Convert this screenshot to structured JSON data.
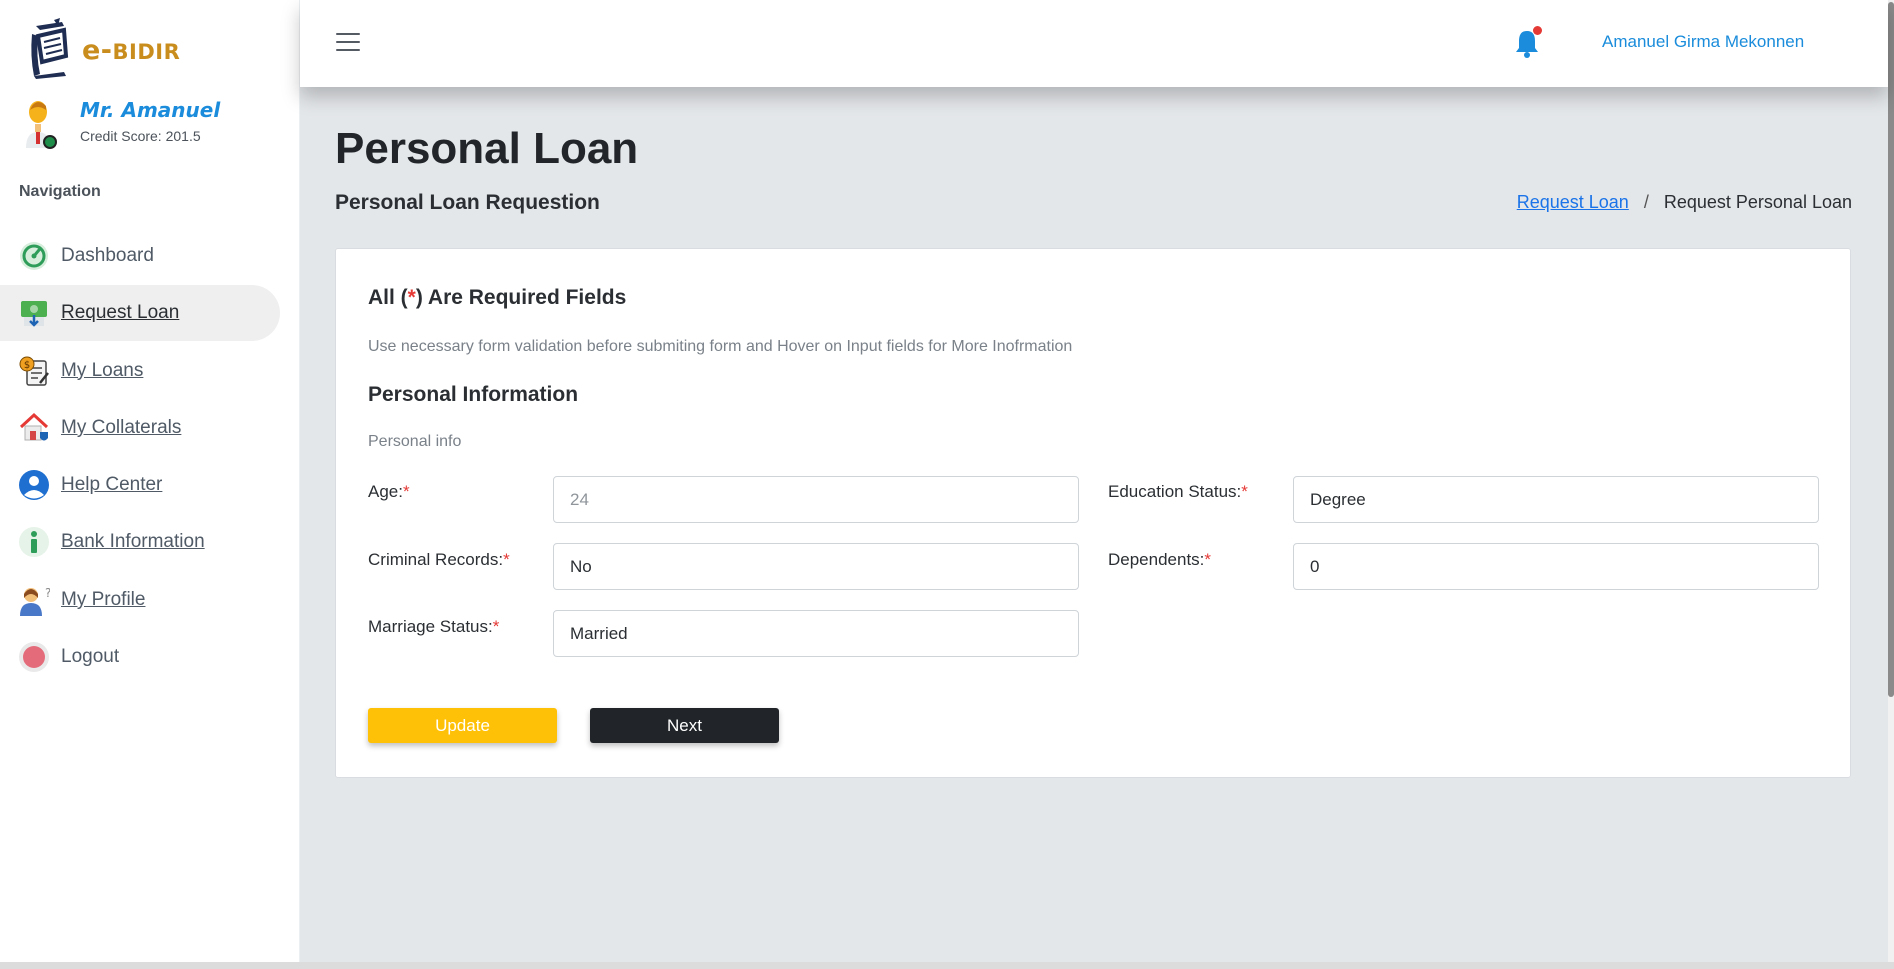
{
  "brand": {
    "prefix": "e-",
    "name": "BIDIR"
  },
  "user": {
    "name": "Mr. Amanuel",
    "credit": "Credit Score: 201.5"
  },
  "nav": {
    "heading": "Navigation",
    "items": [
      {
        "label": "Dashboard",
        "icon": "dashboard-gauge-icon"
      },
      {
        "label": "Request Loan",
        "icon": "money-download-icon"
      },
      {
        "label": "My Loans",
        "icon": "loan-document-icon"
      },
      {
        "label": "My Collaterals",
        "icon": "house-shield-icon"
      },
      {
        "label": "Help Center",
        "icon": "user-circle-icon"
      },
      {
        "label": "Bank Information",
        "icon": "info-icon"
      },
      {
        "label": "My Profile",
        "icon": "profile-person-icon"
      },
      {
        "label": "Logout",
        "icon": "logout-circle-icon"
      }
    ]
  },
  "topbar": {
    "user_name": "Amanuel Girma Mekonnen"
  },
  "page": {
    "title": "Personal Loan",
    "subtitle": "Personal Loan Requestion",
    "breadcrumb": {
      "link": "Request Loan",
      "sep": "/",
      "current": "Request Personal Loan"
    }
  },
  "form": {
    "heading_pre": "All (",
    "heading_star": "*",
    "heading_post": ") Are Required Fields",
    "note": "Use necessary form validation before submiting form and Hover on Input fields for More Inofrmation",
    "section_title": "Personal Information",
    "section_sub": "Personal info",
    "star": "*",
    "fields": {
      "age": {
        "label": "Age:",
        "value": "24"
      },
      "education": {
        "label": "Education Status:",
        "value": "Degree"
      },
      "criminal": {
        "label": "Criminal Records:",
        "value": "No"
      },
      "dependents": {
        "label": "Dependents:",
        "value": "0"
      },
      "marriage": {
        "label": "Marriage Status:",
        "value": "Married"
      }
    },
    "update_label": "Update",
    "next_label": "Next"
  },
  "colors": {
    "accent_blue": "#1a8cdb",
    "brand_gold": "#c98d1e",
    "update_button": "#ffc107",
    "next_button": "#212529",
    "required_star": "#e53935"
  }
}
